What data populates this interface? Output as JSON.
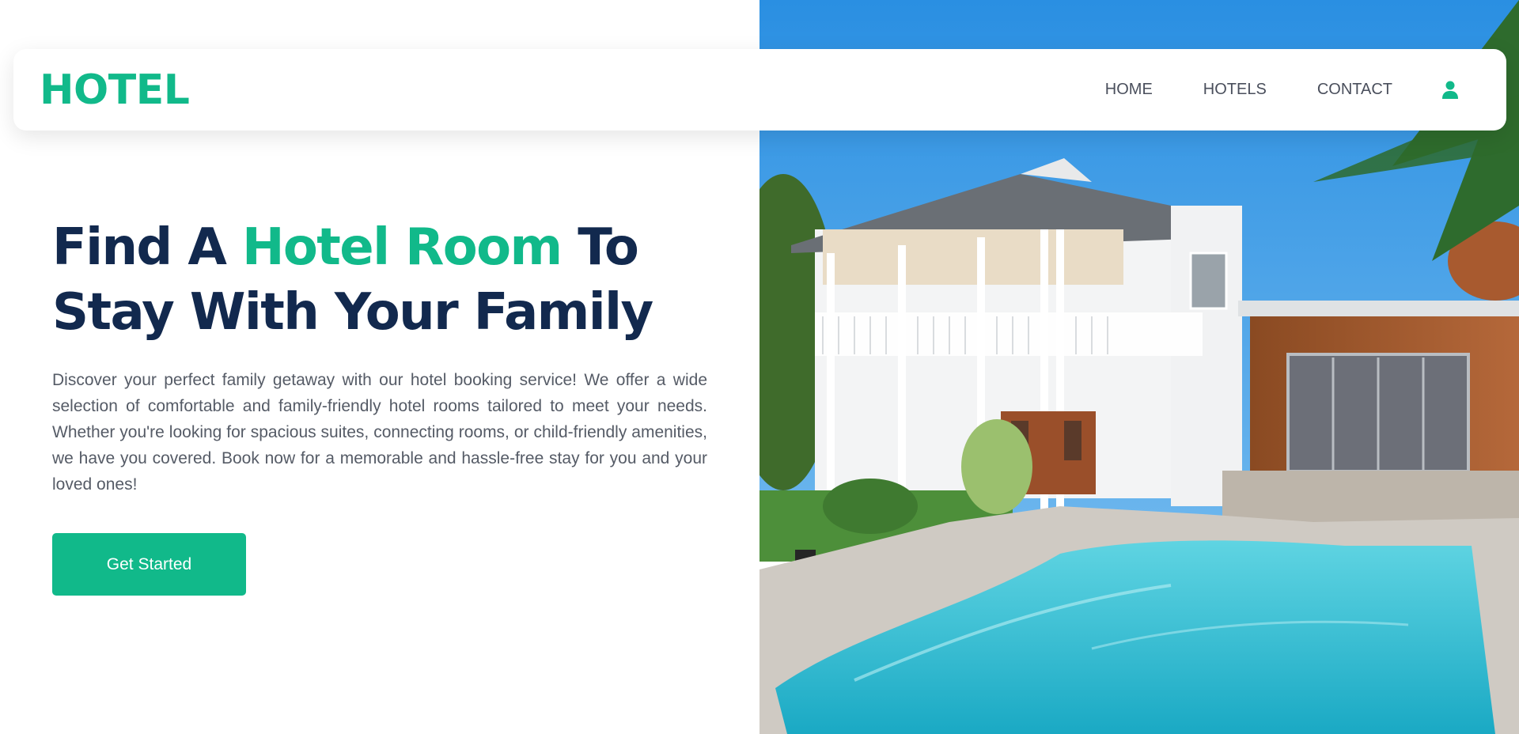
{
  "brand": {
    "logo": "HOTEL",
    "accent_color": "#11b98a",
    "heading_color": "#12294e"
  },
  "nav": {
    "items": [
      {
        "label": "HOME"
      },
      {
        "label": "HOTELS"
      },
      {
        "label": "CONTACT"
      }
    ],
    "user_icon": "user-icon"
  },
  "hero": {
    "title_part1": "Find A ",
    "title_accent": "Hotel Room",
    "title_part2": " To Stay With Your Family",
    "description": "Discover your perfect family getaway with our hotel booking service! We offer a wide selection of comfortable and family-friendly hotel rooms tailored to meet your needs. Whether you're looking for spacious suites, connecting rooms, or child-friendly amenities, we have you covered. Book now for a memorable and hassle-free stay for you and your loved ones!",
    "cta_label": "Get Started"
  }
}
